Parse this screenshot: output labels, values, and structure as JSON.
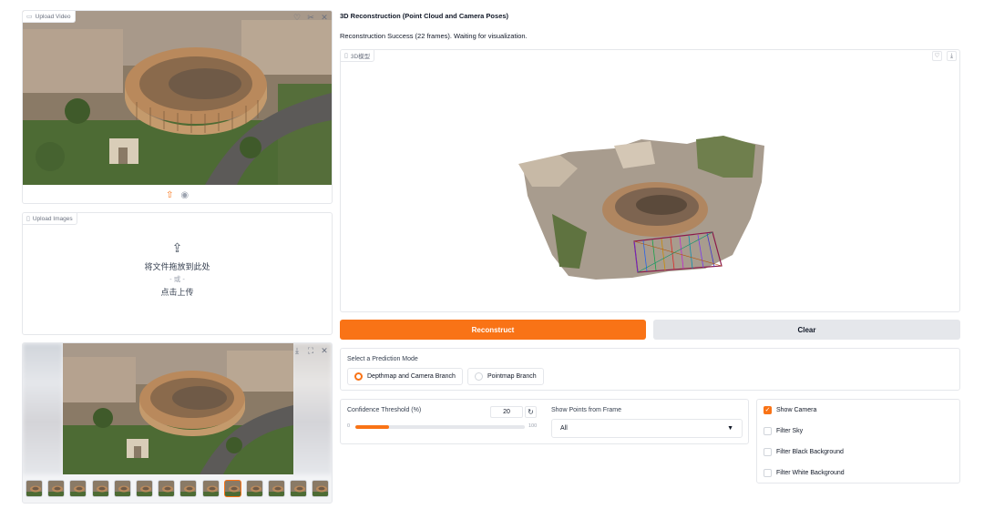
{
  "video": {
    "tag_label": "Upload Video",
    "icons": [
      "heart-icon",
      "scissors-icon",
      "close-icon"
    ],
    "controls": [
      "upload-icon",
      "webcam-icon"
    ]
  },
  "images": {
    "tag_label": "Upload Images",
    "drop_text": "将文件拖放到此处",
    "or_text": "- 或 -",
    "click_text": "点击上传"
  },
  "gallery": {
    "icons": [
      "download-icon",
      "fullscreen-icon",
      "close-icon"
    ],
    "thumb_count": 14,
    "selected_index": 9
  },
  "header": {
    "title": "3D Reconstruction (Point Cloud and Camera Poses)",
    "status": "Reconstruction Success (22 frames). Waiting for visualization."
  },
  "model": {
    "tag_label": "3D模型",
    "icons": [
      "heart-icon",
      "download-icon"
    ]
  },
  "buttons": {
    "reconstruct": "Reconstruct",
    "clear": "Clear"
  },
  "mode": {
    "label": "Select a Prediction Mode",
    "options": [
      {
        "label": "Depthmap and Camera Branch",
        "selected": true
      },
      {
        "label": "Pointmap Branch",
        "selected": false
      }
    ]
  },
  "confidence": {
    "label": "Confidence Threshold (%)",
    "value": "20",
    "min": "0",
    "max": "100",
    "fraction": 0.2
  },
  "frame_filter": {
    "label": "Show Points from Frame",
    "value": "All"
  },
  "checkboxes": [
    {
      "label": "Show Camera",
      "checked": true
    },
    {
      "label": "Filter Sky",
      "checked": false
    },
    {
      "label": "Filter Black Background",
      "checked": false
    },
    {
      "label": "Filter White Background",
      "checked": false
    }
  ],
  "colors": {
    "accent": "#f97316",
    "border": "#e5e7eb"
  }
}
